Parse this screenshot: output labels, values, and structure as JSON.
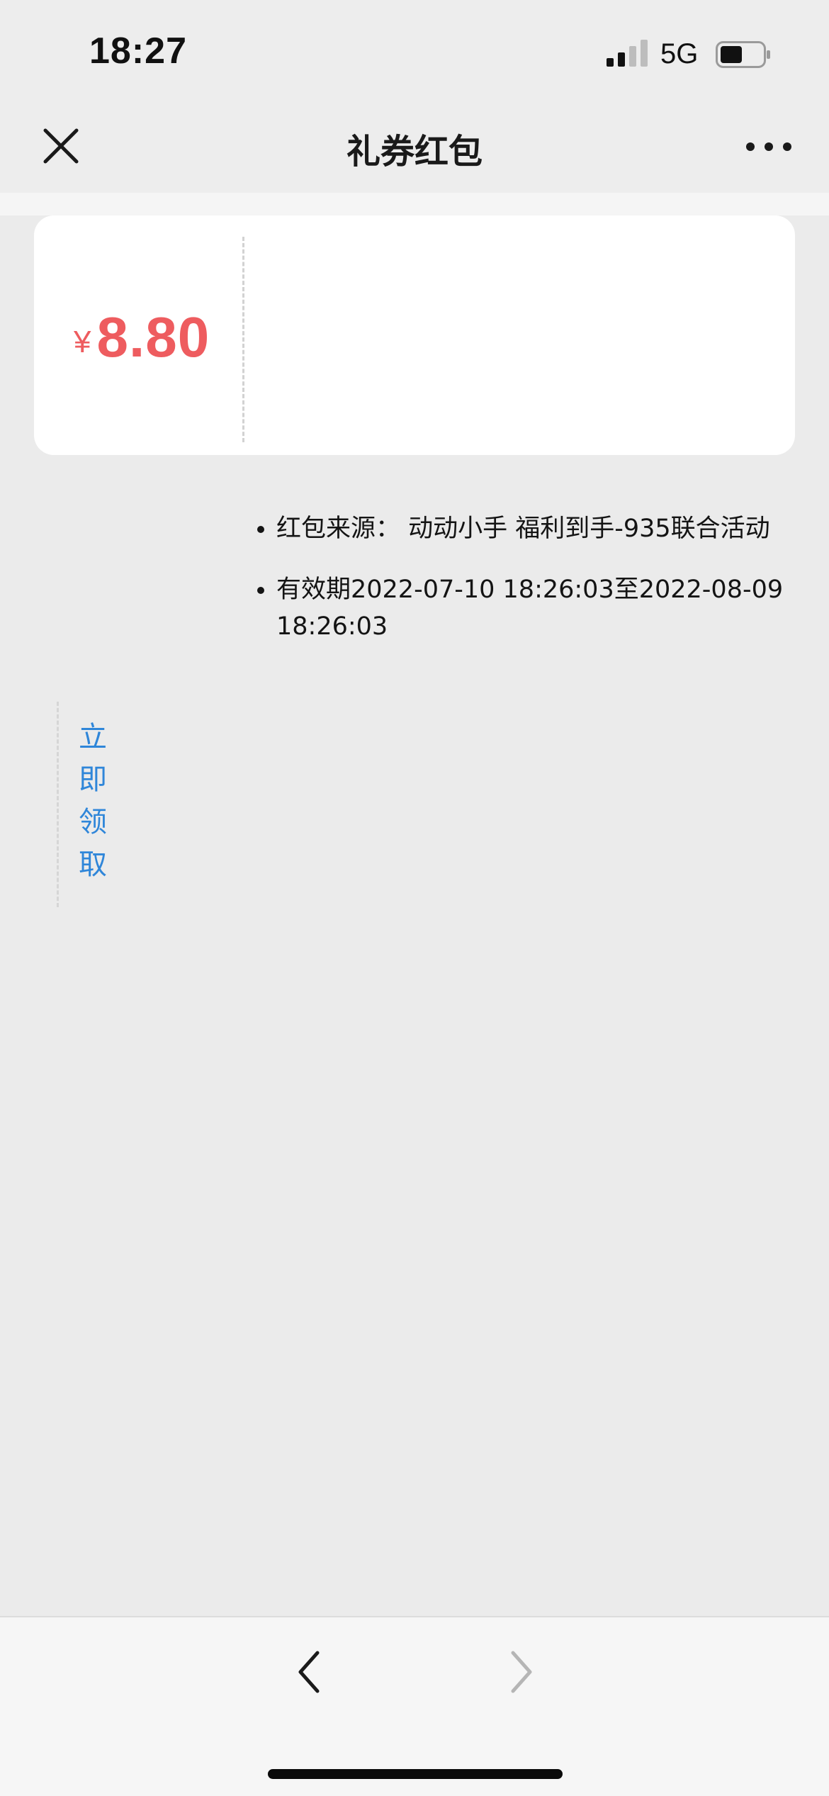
{
  "status_bar": {
    "time": "18:27",
    "network": "5G",
    "icons": [
      "signal-icon",
      "battery-icon"
    ]
  },
  "navbar": {
    "title": "礼券红包",
    "icons": [
      "close-icon",
      "more-icon"
    ]
  },
  "coupon": {
    "currency": "¥",
    "amount": "8.80",
    "accent_color": "#ee5c5f"
  },
  "details": {
    "source": "红包来源：  动动小手 福利到手-935联合活动",
    "validity": "有效期2022-07-10 18:26:03至2022-08-09 18:26:03"
  },
  "claim_button": {
    "label": "立即领取",
    "color": "#2f86d9"
  },
  "bottom_nav": {
    "icons": [
      "chevron-left-icon",
      "chevron-right-icon"
    ]
  }
}
